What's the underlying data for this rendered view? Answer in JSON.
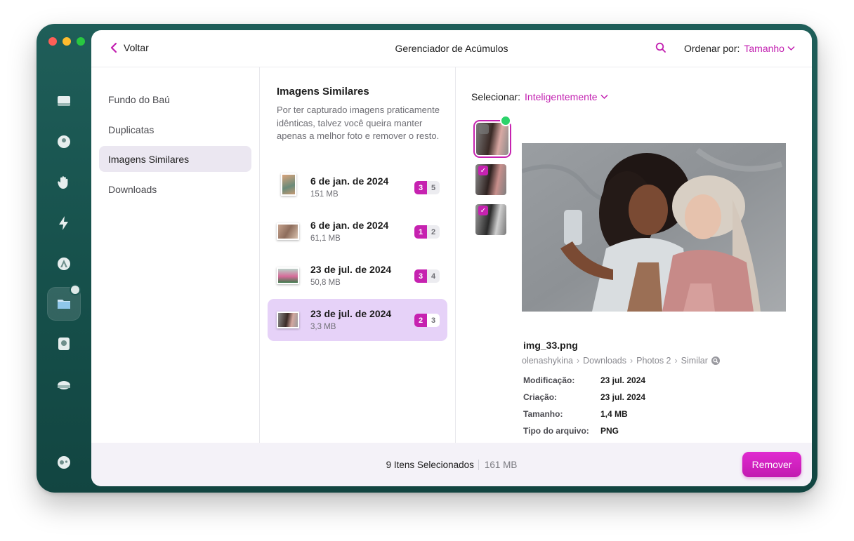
{
  "window": {
    "title": "Gerenciador de Acúmulos"
  },
  "toolbar": {
    "back_label": "Voltar",
    "sort_label": "Ordenar por:",
    "sort_value": "Tamanho"
  },
  "sidebar": {
    "rail_icons": [
      "drive-icon",
      "cleanup-icon",
      "hand-icon",
      "bolt-icon",
      "apps-icon",
      "folder-icon",
      "disk-icon",
      "cloud-icon",
      "settings-icon"
    ],
    "items": [
      {
        "label": "Fundo do Baú"
      },
      {
        "label": "Duplicatas"
      },
      {
        "label": "Imagens Similares"
      },
      {
        "label": "Downloads"
      }
    ]
  },
  "section": {
    "title": "Imagens Similares",
    "description": "Por ter capturado imagens praticamente idênticas, talvez você queira manter apenas a melhor foto e remover o resto."
  },
  "groups": [
    {
      "date": "6 de jan. de 2024",
      "size": "151 MB",
      "selected": "3",
      "total": "5"
    },
    {
      "date": "6 de jan. de 2024",
      "size": "61,1 MB",
      "selected": "1",
      "total": "2"
    },
    {
      "date": "23 de jul. de 2024",
      "size": "50,8 MB",
      "selected": "3",
      "total": "4"
    },
    {
      "date": "23 de jul. de 2024",
      "size": "3,3 MB",
      "selected": "2",
      "total": "3"
    }
  ],
  "detail": {
    "select_label": "Selecionar:",
    "select_value": "Inteligentemente",
    "filename": "img_33.png",
    "path": [
      "olenashykina",
      "Downloads",
      "Photos 2",
      "Similar"
    ],
    "meta": [
      {
        "key": "Modificação:",
        "value": "23 jul. 2024"
      },
      {
        "key": "Criação:",
        "value": "23 jul. 2024"
      },
      {
        "key": "Tamanho:",
        "value": "1,4 MB"
      },
      {
        "key": "Tipo do arquivo:",
        "value": "PNG"
      }
    ]
  },
  "footer": {
    "count_label": "9 Itens Selecionados",
    "size_label": "161 MB",
    "remove_label": "Remover"
  },
  "colors": {
    "accent": "#c622b0",
    "rail": "#1f5e59",
    "selection": "#e6d2f8"
  }
}
